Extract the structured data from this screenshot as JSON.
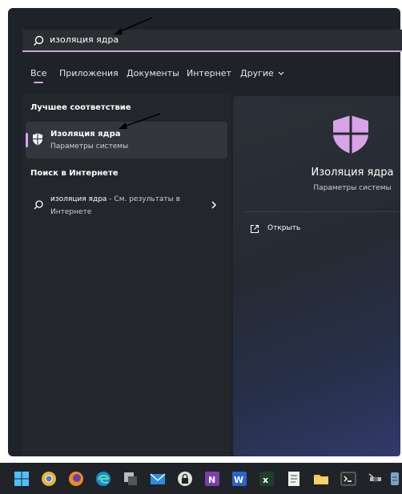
{
  "search": {
    "value": "изоляция ядра"
  },
  "tabs": [
    {
      "label": "Все"
    },
    {
      "label": "Приложения"
    },
    {
      "label": "Документы"
    },
    {
      "label": "Интернет"
    },
    {
      "label": "Другие"
    }
  ],
  "left": {
    "best_match_heading": "Лучшее соответствие",
    "best_match": {
      "title": "Изоляция ядра",
      "subtitle": "Параметры системы"
    },
    "web_heading": "Поиск в Интернете",
    "web_result": {
      "query": "изоляция ядра",
      "suffix": " - См. результаты в",
      "line2": "Интернете"
    }
  },
  "right": {
    "title": "Изоляция ядра",
    "subtitle": "Параметры системы",
    "actions": [
      {
        "label": "Открыть",
        "icon": "open-external-icon"
      }
    ]
  },
  "colors": {
    "accent": "#d4a7f2",
    "panel": "#1f2329",
    "taskbar": "#202327"
  },
  "taskbar": {
    "icons": [
      "windows-start-icon",
      "chrome-icon",
      "firefox-icon",
      "edge-icon",
      "app-icon",
      "mail-icon",
      "lock-app-icon",
      "onenote-icon",
      "word-icon",
      "excel-icon",
      "notepad-icon",
      "explorer-icon",
      "terminal-icon",
      "tools-icon",
      "storage-icon"
    ]
  }
}
